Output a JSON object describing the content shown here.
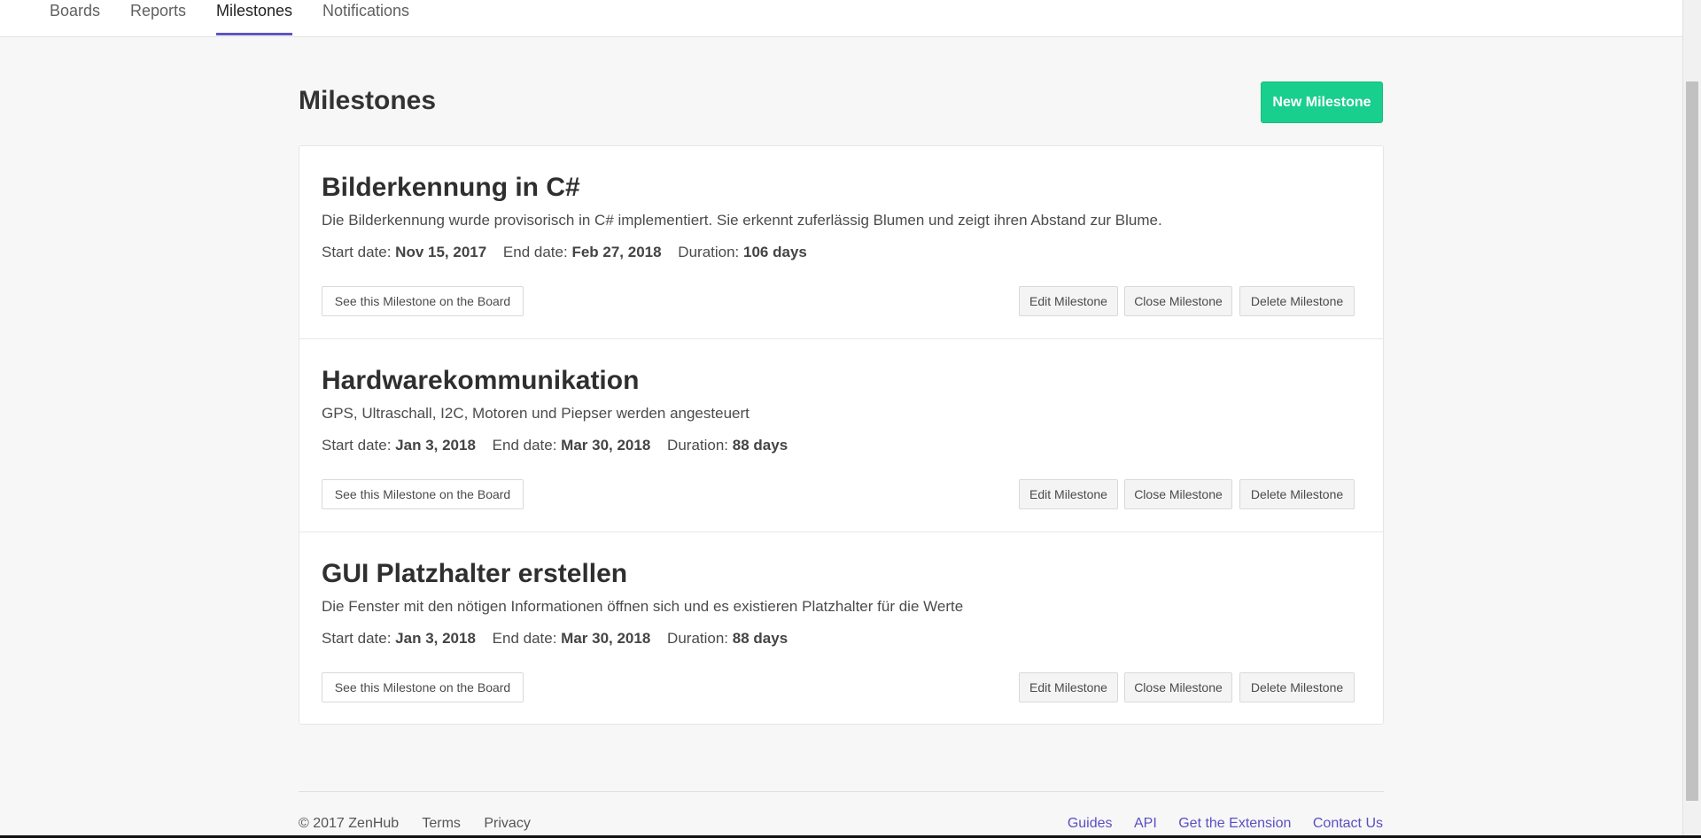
{
  "nav": {
    "tabs": [
      "Boards",
      "Reports",
      "Milestones",
      "Notifications"
    ],
    "active_tab": "Milestones"
  },
  "page": {
    "title": "Milestones",
    "new_button": "New Milestone"
  },
  "labels": {
    "start": "Start date:",
    "end": "End date:",
    "duration": "Duration:",
    "board": "See this Milestone on the Board",
    "edit": "Edit Milestone",
    "close": "Close Milestone",
    "delete": "Delete Milestone"
  },
  "milestones": [
    {
      "title": "Bilderkennung in C#",
      "description": "Die Bilderkennung wurde provisorisch in C# implementiert. Sie erkennt zuferlässig Blumen und zeigt ihren Abstand zur Blume.",
      "start_date": "Nov 15, 2017",
      "end_date": "Feb 27, 2018",
      "duration": "106 days"
    },
    {
      "title": "Hardwarekommunikation",
      "description": "GPS, Ultraschall, I2C, Motoren und Piepser werden angesteuert",
      "start_date": "Jan 3, 2018",
      "end_date": "Mar 30, 2018",
      "duration": "88 days"
    },
    {
      "title": "GUI Platzhalter erstellen",
      "description": "Die Fenster mit den nötigen Informationen öffnen sich und es existieren Platzhalter für die Werte",
      "start_date": "Jan 3, 2018",
      "end_date": "Mar 30, 2018",
      "duration": "88 days"
    }
  ],
  "footer": {
    "copyright": "© 2017 ZenHub",
    "left_links": [
      "Terms",
      "Privacy"
    ],
    "right_links": [
      "Guides",
      "API",
      "Get the Extension",
      "Contact Us"
    ]
  },
  "colors": {
    "accent": "#5d55c3",
    "primary_button": "#19cf8d",
    "link": "#5a4fc4"
  }
}
